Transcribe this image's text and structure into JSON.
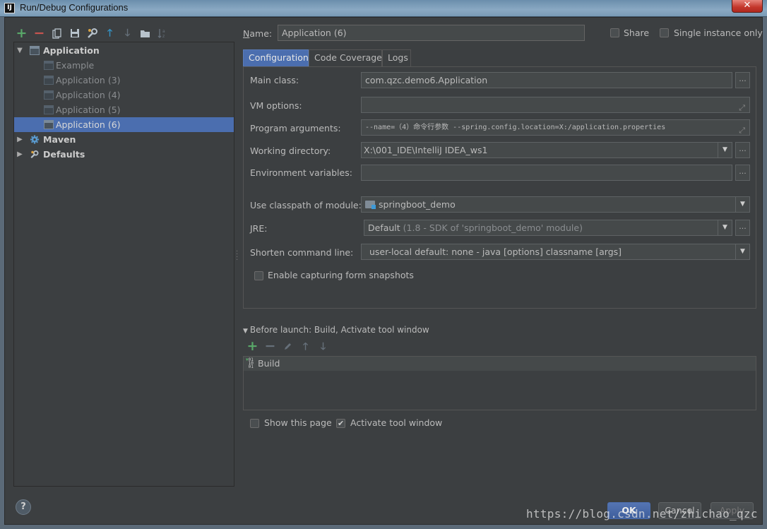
{
  "window": {
    "title": "Run/Debug Configurations",
    "close_glyph": "✕"
  },
  "colors": {
    "accent": "#4b6eaf",
    "add": "#59a869",
    "remove": "#c75450",
    "up_arrow": "#3592c4",
    "background": "#3c3f41"
  },
  "left_toolbar": {
    "icons": [
      "add-icon",
      "remove-icon",
      "copy-icon",
      "save-icon",
      "wrench-icon",
      "move-up-icon",
      "move-down-icon",
      "folder-icon",
      "sort-icon"
    ],
    "glyphs": {
      "add": "+",
      "remove": "−",
      "up": "🡑",
      "down": "🡓"
    }
  },
  "tree": {
    "application": "Application",
    "children": [
      "Example",
      "Application (3)",
      "Application (4)",
      "Application (5)",
      "Application (6)"
    ],
    "maven": "Maven",
    "defaults": "Defaults"
  },
  "name": {
    "label": "Name:",
    "value": "Application (6)"
  },
  "share": {
    "label": "Share",
    "checked": false
  },
  "single_instance": {
    "label": "Single instance only",
    "checked": false
  },
  "tabs": [
    "Configuration",
    "Code Coverage",
    "Logs"
  ],
  "config": {
    "main_class": {
      "label": "Main class:",
      "value": "com.qzc.demo6.Application"
    },
    "vm_options": {
      "label": "VM options:",
      "value": ""
    },
    "program_arguments": {
      "label": "Program arguments:",
      "value": "--name=（4）命令行参数 --spring.config.location=X:/application.properties"
    },
    "working_directory": {
      "label": "Working directory:",
      "value": "X:\\001_IDE\\IntelliJ IDEA_ws1"
    },
    "environment_variables": {
      "label": "Environment variables:",
      "value": ""
    },
    "classpath_module": {
      "label": "Use classpath of module:",
      "value": "springboot_demo"
    },
    "jre": {
      "label": "JRE:",
      "value": "Default",
      "hint": "(1.8 - SDK of 'springboot_demo' module)"
    },
    "shorten_command_line": {
      "label": "Shorten command line:",
      "value": "user-local default: none - java [options] classname [args]"
    },
    "capture_snapshots": {
      "label": "Enable capturing form snapshots",
      "checked": false
    }
  },
  "before_launch": {
    "title": "Before launch: Build, Activate tool window",
    "items": [
      "Build"
    ]
  },
  "show_page": {
    "label": "Show this page",
    "checked": false
  },
  "activate_tool_window": {
    "label": "Activate tool window",
    "checked": true
  },
  "buttons": {
    "ok": "OK",
    "cancel": "Cancel",
    "apply": "Apply",
    "help": "?"
  },
  "watermark": "https://blog.csdn.net/zhichao_qzc"
}
